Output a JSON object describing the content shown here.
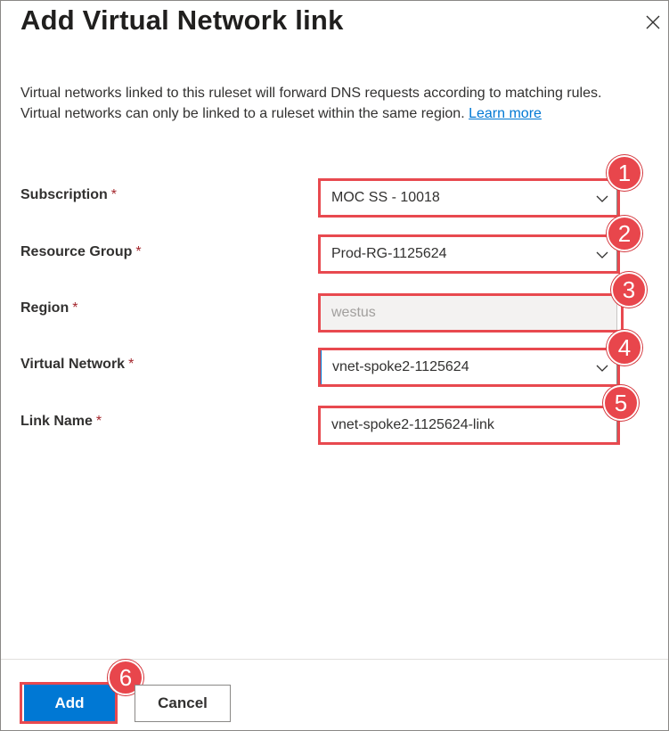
{
  "panel": {
    "title": "Add Virtual Network link",
    "close_icon": "close-icon"
  },
  "description": {
    "line1": "Virtual networks linked to this ruleset will forward DNS requests according to matching rules.",
    "line2": "Virtual networks can only be linked to a ruleset within the same region.",
    "link_text": "Learn more"
  },
  "form": {
    "required_mark": "*",
    "subscription": {
      "label": "Subscription",
      "value": "MOC SS - 10018",
      "badge": "1"
    },
    "resource_group": {
      "label": "Resource Group",
      "value": "Prod-RG-1125624",
      "badge": "2"
    },
    "region": {
      "label": "Region",
      "value": "westus",
      "badge": "3"
    },
    "virtual_network": {
      "label": "Virtual Network",
      "value": "vnet-spoke2-1125624",
      "badge": "4"
    },
    "link_name": {
      "label": "Link Name",
      "value": "vnet-spoke2-1125624-link",
      "badge": "5"
    }
  },
  "footer": {
    "add_label": "Add",
    "cancel_label": "Cancel",
    "add_badge": "6"
  },
  "colors": {
    "accent": "#0078d4",
    "highlight": "#e8494f",
    "required": "#a4262c"
  }
}
